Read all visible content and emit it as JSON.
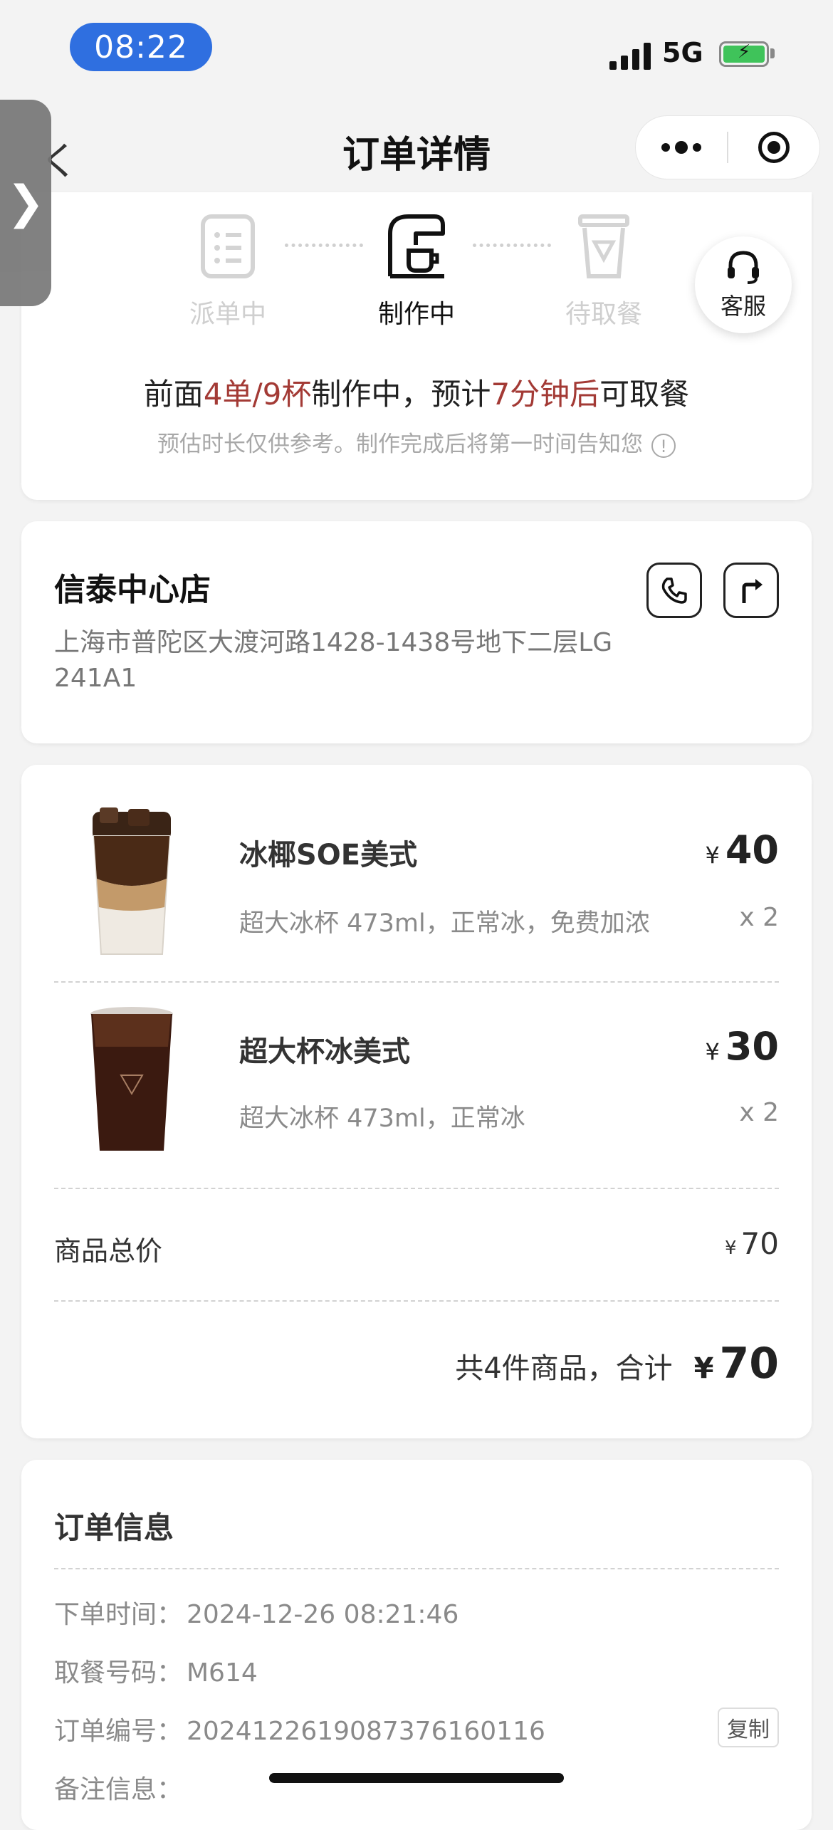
{
  "status_bar": {
    "time": "08:22",
    "network": "5G"
  },
  "header": {
    "title": "订单详情",
    "back_glyph": "く"
  },
  "side_tab": {
    "glyph": "❯"
  },
  "steps": [
    {
      "label": "派单中",
      "icon": "list-icon",
      "state": "done"
    },
    {
      "label": "制作中",
      "icon": "coffee-machine-icon",
      "state": "active"
    },
    {
      "label": "待取餐",
      "icon": "cup-icon",
      "state": "pending"
    }
  ],
  "service": {
    "label": "客服",
    "icon": "headset-icon"
  },
  "progress": {
    "prefix": "前面",
    "queue": "4单/9杯",
    "middle": "制作中，预计",
    "eta": "7分钟后",
    "suffix": "可取餐",
    "note": "预估时长仅供参考。制作完成后将第一时间告知您",
    "note_icon": "!"
  },
  "store": {
    "name": "信泰中心店",
    "address": "上海市普陀区大渡河路1428-1438号地下二层LG 241A1"
  },
  "products": [
    {
      "name": "冰椰SOE美式",
      "spec": "超大冰杯 473ml，正常冰，免费加浓",
      "price": "40",
      "qty": "x 2"
    },
    {
      "name": "超大杯冰美式",
      "spec": "超大冰杯 473ml，正常冰",
      "price": "30",
      "qty": "x 2"
    }
  ],
  "currency": "¥",
  "subtotal": {
    "label": "商品总价",
    "value": "70"
  },
  "total": {
    "label": "共4件商品，合计",
    "value": "70"
  },
  "order_info": {
    "title": "订单信息",
    "rows": [
      {
        "key": "下单时间：",
        "value": "2024-12-26 08:21:46"
      },
      {
        "key": "取餐号码：",
        "value": "M614"
      },
      {
        "key": "订单编号：",
        "value": "20241226190873761601​16"
      },
      {
        "key": "备注信息：",
        "value": ""
      }
    ],
    "copy_label": "复制"
  },
  "colors": {
    "accent_red": "#a33a35",
    "time_pill": "#2f6fe0",
    "battery": "#3fc35a"
  }
}
